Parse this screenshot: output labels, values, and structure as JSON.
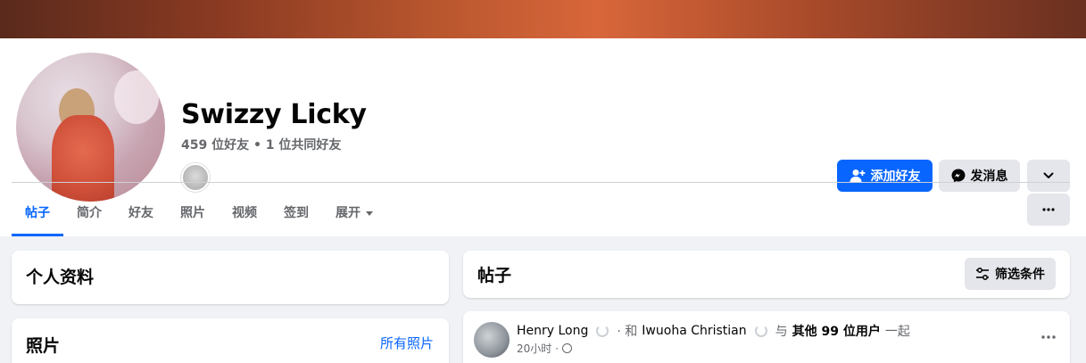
{
  "profile": {
    "name": "Swizzy Licky",
    "friends_summary": "459 位好友 • 1 位共同好友"
  },
  "actions": {
    "add_friend": "添加好友",
    "message": "发消息"
  },
  "tabs": [
    {
      "label": "帖子"
    },
    {
      "label": "简介"
    },
    {
      "label": "好友"
    },
    {
      "label": "照片"
    },
    {
      "label": "视频"
    },
    {
      "label": "签到"
    },
    {
      "label": "展开"
    }
  ],
  "cards": {
    "profile_title": "个人资料",
    "photos_title": "照片",
    "all_photos": "所有照片",
    "posts_title": "帖子",
    "filter": "筛选条件"
  },
  "feed": {
    "author": "Henry Long",
    "and": "· 和",
    "tagged": "Iwuoha Christian",
    "with": "与",
    "others": "其他 99 位用户",
    "together": "一起",
    "time": "20小时 ·"
  },
  "colors": {
    "accent": "#0866ff",
    "secondary_button": "#e4e6eb",
    "muted_text": "#65676b",
    "page_bg": "#f0f2f5"
  },
  "icons": {
    "add_friend": "person-plus-icon",
    "message": "messenger-icon",
    "dropdown": "chevron-down-icon",
    "more": "more-dots-icon",
    "filter": "filter-sliders-icon",
    "privacy": "globe-icon"
  }
}
